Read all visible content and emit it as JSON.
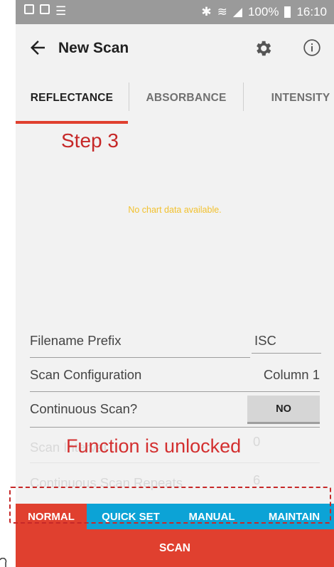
{
  "status_bar": {
    "battery": "100%",
    "time": "16:10"
  },
  "app_bar": {
    "title": "New Scan",
    "icons": [
      "back-arrow-icon",
      "gear-icon",
      "info-icon"
    ]
  },
  "tabs": [
    {
      "label": "REFLECTANCE",
      "active": true
    },
    {
      "label": "ABSORBANCE",
      "active": false
    },
    {
      "label": "INTENSITY",
      "active": false
    }
  ],
  "annotations": {
    "step": "Step 3",
    "unlocked": "Function is unlocked"
  },
  "chart": {
    "empty_message": "No chart data available."
  },
  "form": {
    "filename_prefix_label": "Filename Prefix",
    "filename_prefix_value": "ISC",
    "scan_config_label": "Scan Configuration",
    "scan_config_value": "Column 1",
    "continuous_scan_label": "Continuous Scan?",
    "continuous_scan_value": "NO",
    "scan_interval_label": "Scan Interval",
    "scan_interval_value": "0",
    "continuous_repeats_label": "Continuous Scan Repeats",
    "continuous_repeats_value": "6"
  },
  "modes": [
    {
      "label": "NORMAL",
      "active": true
    },
    {
      "label": "QUICK SET",
      "active": false
    },
    {
      "label": "MANUAL",
      "active": false
    },
    {
      "label": "MAINTAIN",
      "active": false
    }
  ],
  "scan_button": "SCAN",
  "colors": {
    "accent": "#e0402f",
    "mode_bar": "#0ca3d6",
    "annotation": "#c62828",
    "empty_message": "#f2c12e"
  }
}
